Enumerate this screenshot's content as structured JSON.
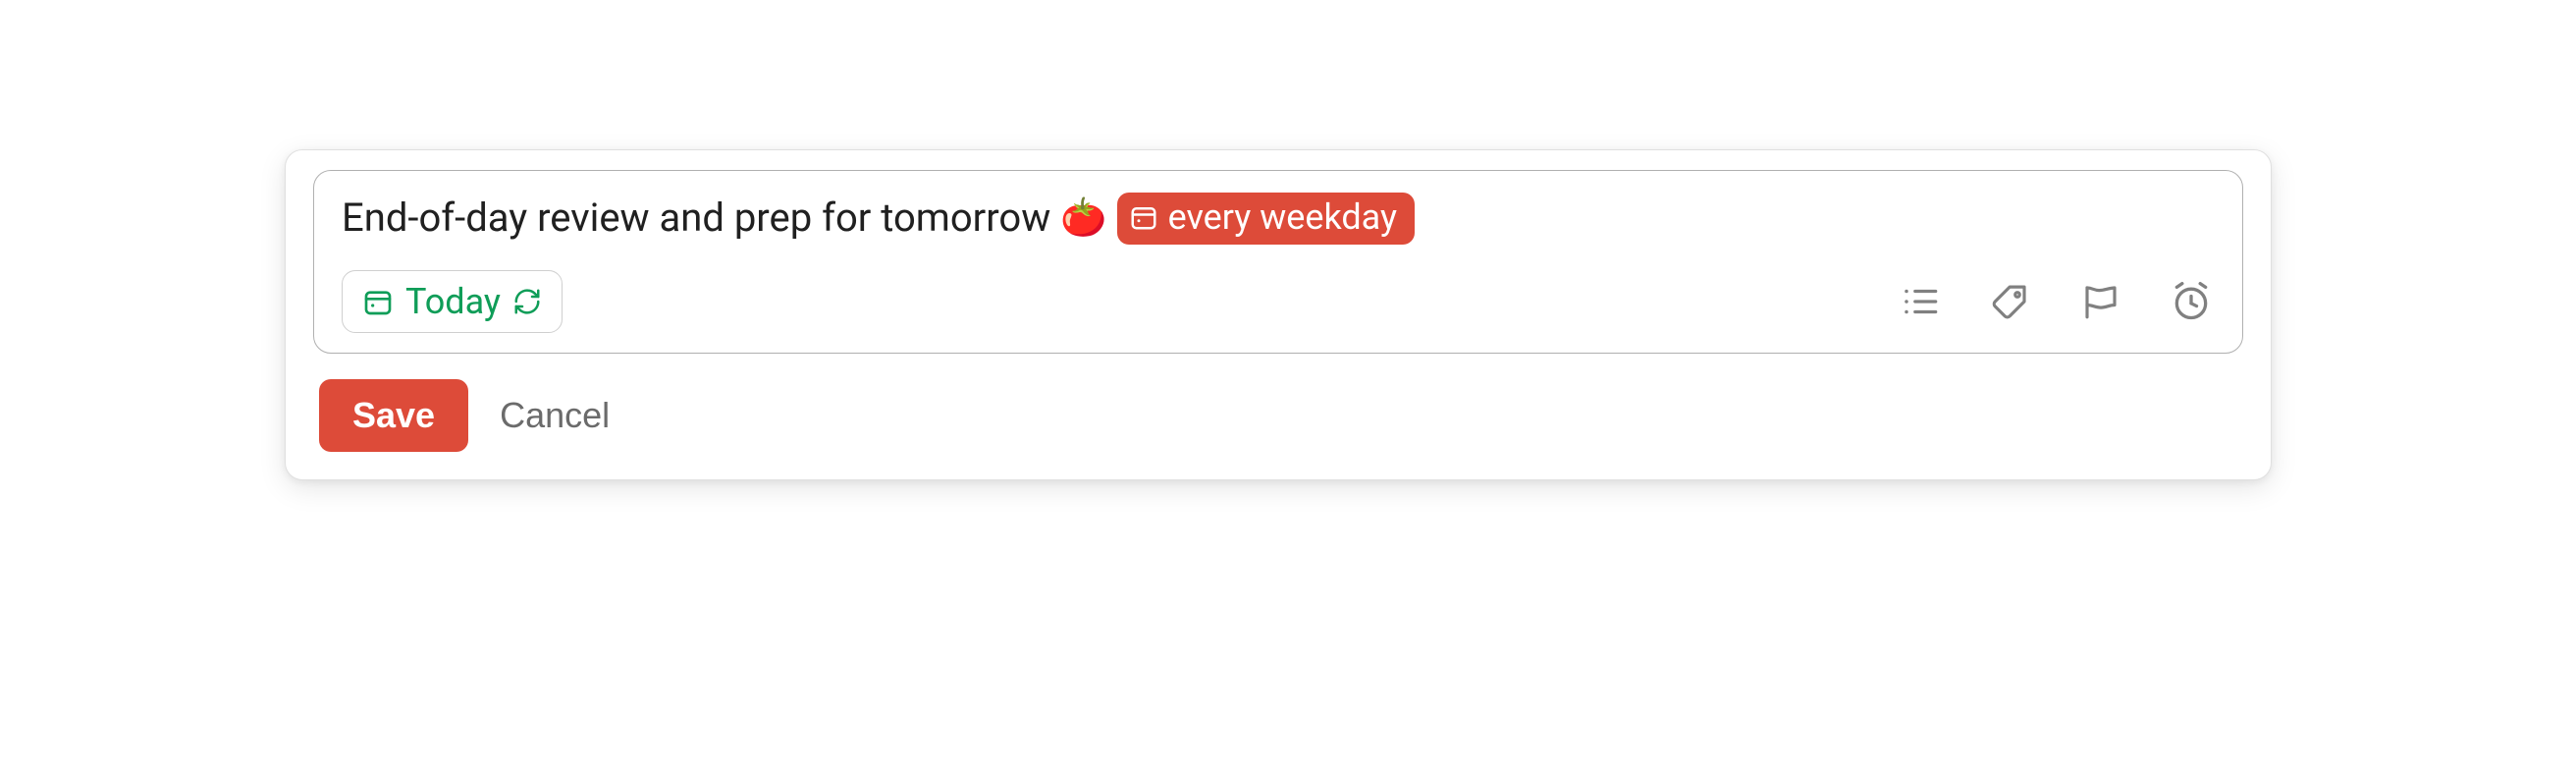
{
  "task": {
    "title": "End-of-day review and prep for tomorrow",
    "emoji": "🍅",
    "recurrence_label": "every weekday",
    "date_label": "Today"
  },
  "buttons": {
    "save": "Save",
    "cancel": "Cancel"
  }
}
